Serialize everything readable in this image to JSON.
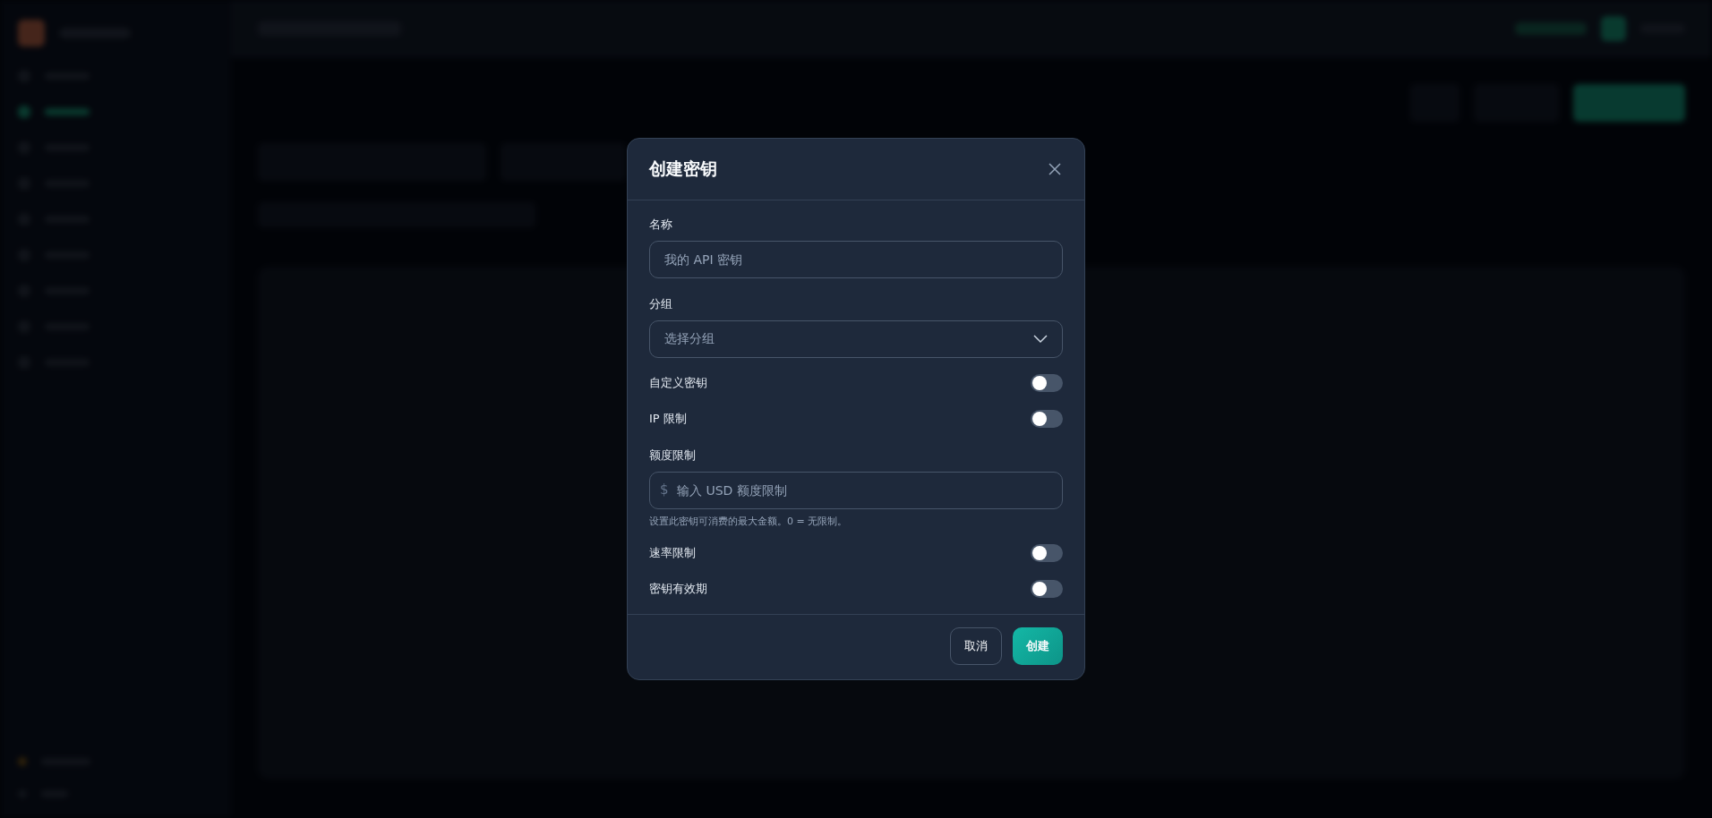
{
  "dialog": {
    "title": "创建密钥",
    "fields": [
      {
        "kind": "text",
        "label": "名称",
        "placeholder": "我的 API 密钥"
      },
      {
        "kind": "select",
        "label": "分组",
        "placeholder": "选择分组"
      },
      {
        "kind": "switch",
        "label": "自定义密钥",
        "on": false
      },
      {
        "kind": "switch",
        "label": "IP 限制",
        "on": false
      },
      {
        "kind": "money",
        "label": "额度限制",
        "prefix": "$",
        "placeholder": "输入 USD 额度限制",
        "hint": "设置此密钥可消费的最大金额。0 = 无限制。"
      },
      {
        "kind": "switch",
        "label": "速率限制",
        "on": false
      },
      {
        "kind": "switch",
        "label": "密钥有效期",
        "on": false
      }
    ],
    "buttons": [
      {
        "kind": "secondary",
        "label": "取消"
      },
      {
        "kind": "primary",
        "label": "创建"
      }
    ]
  }
}
